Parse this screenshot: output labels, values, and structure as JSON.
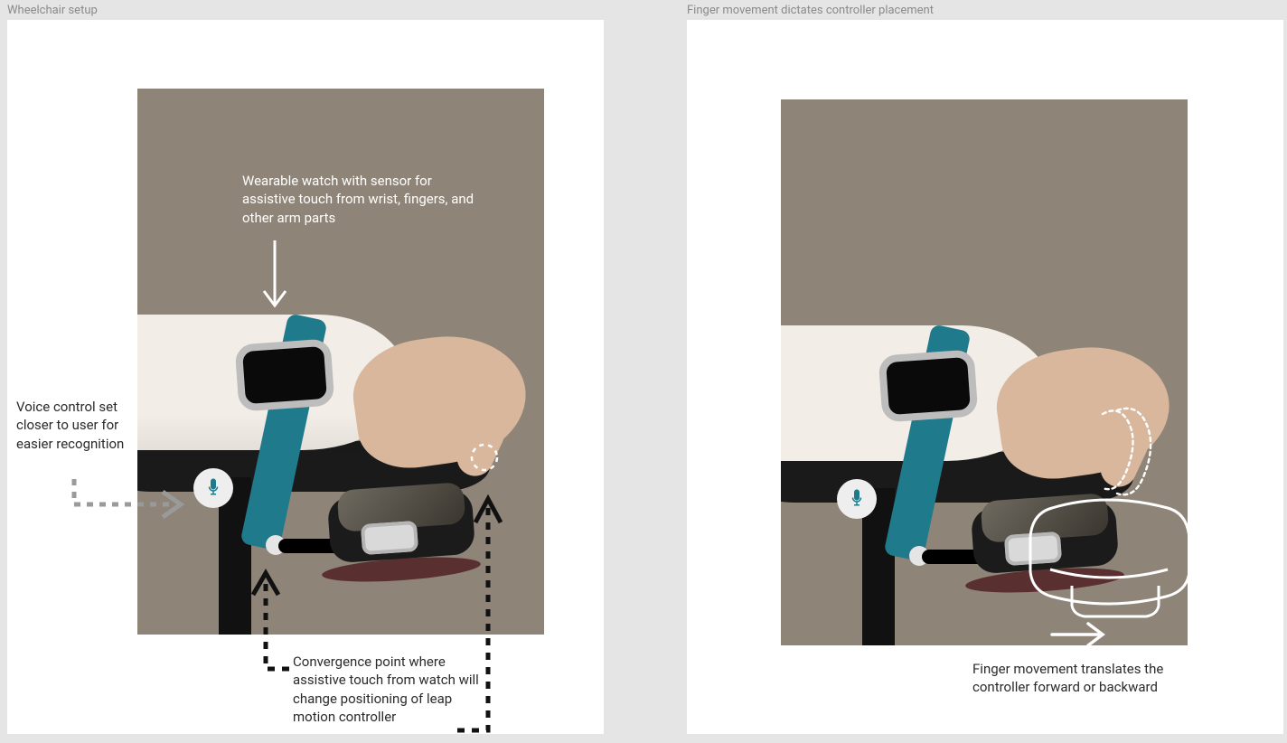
{
  "labels": {
    "left_panel": "Wheelchair setup",
    "right_panel": "Finger movement dictates controller placement"
  },
  "left": {
    "watch_annotation": "Wearable watch with sensor for assistive touch from wrist, fingers, and other arm parts",
    "voice_annotation": "Voice control set closer to user for easier recognition",
    "convergence_annotation": "Convergence point where assistive touch from watch will change positioning of leap motion controller"
  },
  "right": {
    "finger_annotation": "Finger movement translates the controller forward or backward"
  },
  "icons": {
    "mic": "microphone-icon",
    "arrow_down": "arrow-down-icon",
    "arrow_right": "arrow-right-icon",
    "dashed_arrow": "dashed-arrow-icon",
    "finger_motion": "finger-motion-outline-icon",
    "controller_translate": "controller-translate-outline-icon"
  },
  "colors": {
    "accent_teal": "#1f7a8c",
    "photo_bg": "#8e8478",
    "page_bg": "#e5e5e5"
  }
}
